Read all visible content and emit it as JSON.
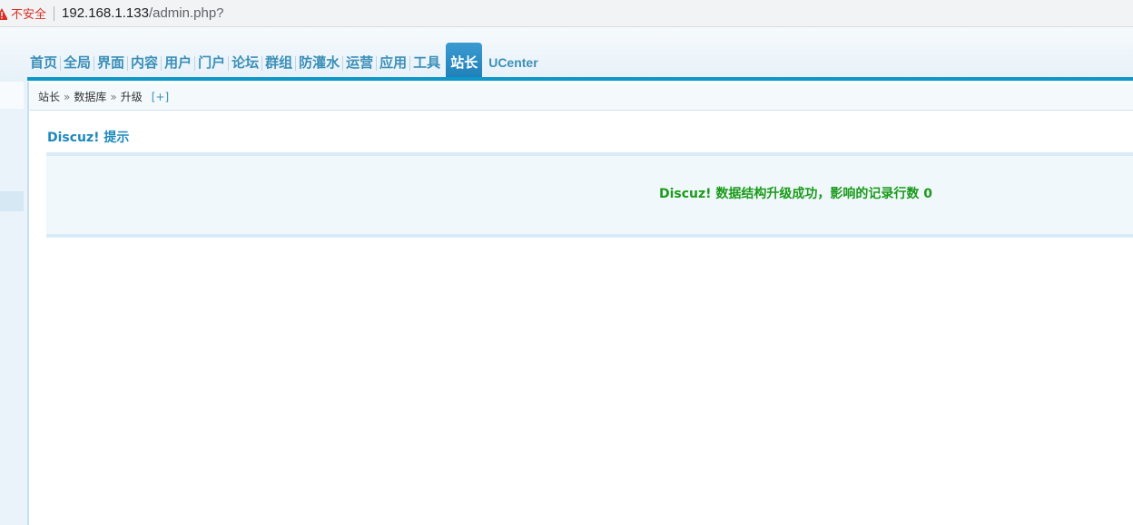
{
  "browser": {
    "security_label": "不安全",
    "url_host": "192.168.1.133",
    "url_path": "/admin.php?"
  },
  "nav": {
    "items": [
      "首页",
      "全局",
      "界面",
      "内容",
      "用户",
      "门户",
      "论坛",
      "群组",
      "防灌水",
      "运营",
      "应用",
      "工具"
    ],
    "active": "站长",
    "ucenter": "UCenter"
  },
  "breadcrumb": {
    "parts": [
      "站长",
      "数据库",
      "升级"
    ],
    "separator": "»",
    "expand": "[+]"
  },
  "content": {
    "title": "Discuz! 提示",
    "message": "Discuz! 数据结构升级成功，影响的记录行数 0"
  },
  "colors": {
    "accent": "#0f98c7",
    "nav_text": "#3b8fb8",
    "success": "#1b9a1b",
    "warning": "#d93025"
  }
}
